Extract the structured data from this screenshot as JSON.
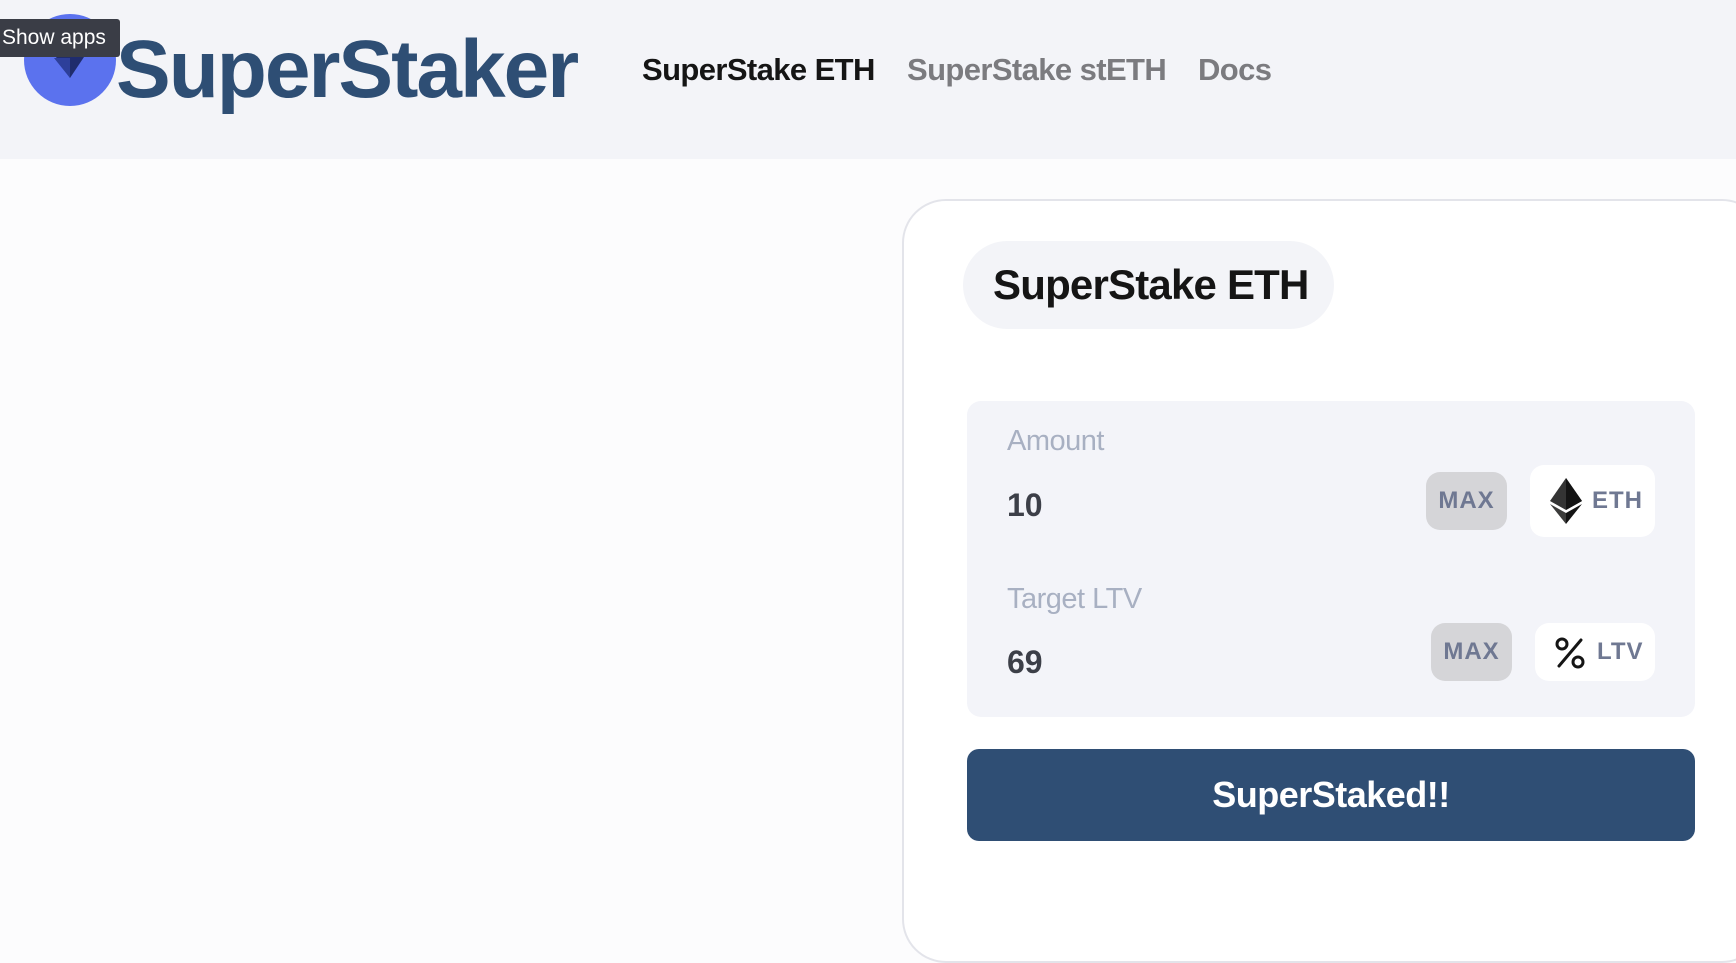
{
  "header": {
    "brand": "SuperStaker",
    "tooltip": "Show apps",
    "nav": [
      {
        "label": "SuperStake ETH",
        "active": true
      },
      {
        "label": "SuperStake stETH",
        "active": false
      },
      {
        "label": "Docs",
        "active": false
      }
    ]
  },
  "card": {
    "title": "SuperStake ETH",
    "amount": {
      "label": "Amount",
      "value": "10",
      "max_label": "MAX",
      "unit": "ETH",
      "unit_icon": "ethereum-icon"
    },
    "target_ltv": {
      "label": "Target LTV",
      "value": "69",
      "max_label": "MAX",
      "unit": "LTV",
      "unit_icon": "percent-icon"
    },
    "submit_label": "SuperStaked!!"
  },
  "colors": {
    "brand": "#2e4e74",
    "button": "#2f4e74",
    "logo": "#5b72ee"
  }
}
